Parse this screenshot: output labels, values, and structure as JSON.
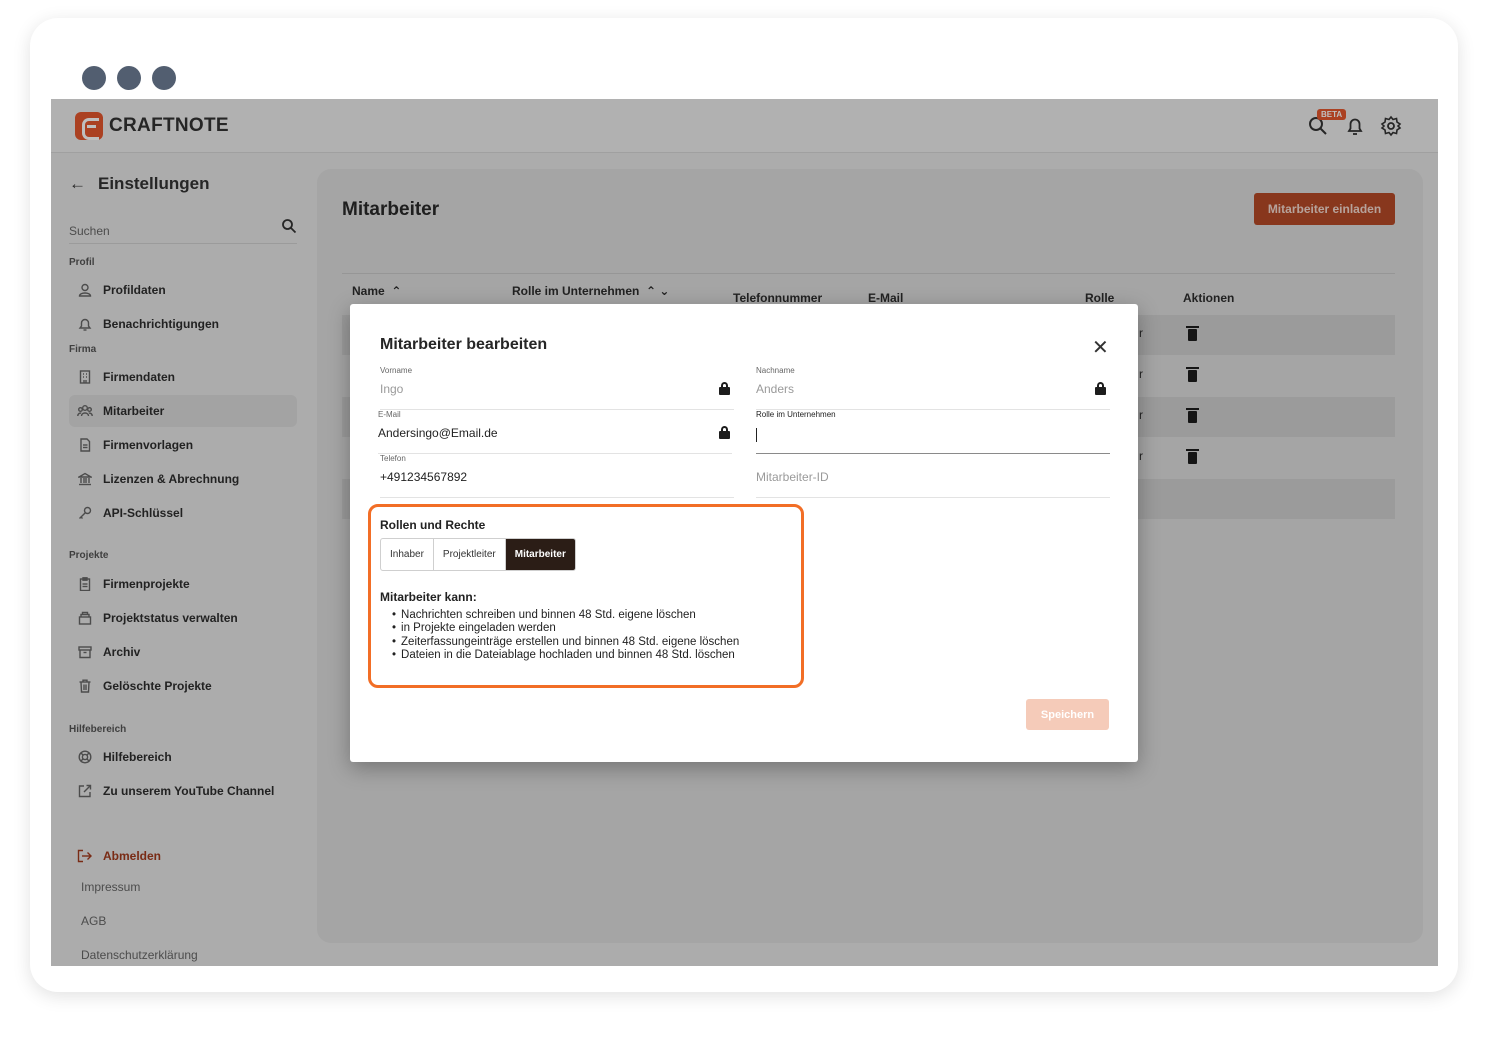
{
  "app": {
    "brand": "CRAFTNOTE",
    "beta_badge": "BETA"
  },
  "sidebar": {
    "back_label": "Einstellungen",
    "search_placeholder": "Suchen",
    "sections": {
      "profil": "Profil",
      "firma": "Firma",
      "projekte": "Projekte",
      "hilfe": "Hilfebereich"
    },
    "items": {
      "profildaten": "Profildaten",
      "benachrichtigungen": "Benachrichtigungen",
      "firmendaten": "Firmendaten",
      "mitarbeiter": "Mitarbeiter",
      "firmenvorlagen": "Firmenvorlagen",
      "lizenzen": "Lizenzen & Abrechnung",
      "api": "API-Schlüssel",
      "firmenprojekte": "Firmenprojekte",
      "projektstatus": "Projektstatus verwalten",
      "archiv": "Archiv",
      "geloeschte": "Gelöschte Projekte",
      "hilfebereich": "Hilfebereich",
      "youtube": "Zu unserem YouTube Channel"
    },
    "logout": "Abmelden",
    "footer": {
      "impressum": "Impressum",
      "agb": "AGB",
      "datenschutz": "Datenschutzerklärung"
    }
  },
  "main": {
    "title": "Mitarbeiter",
    "invite_button": "Mitarbeiter einladen",
    "columns": {
      "name": "Name",
      "rolle_unternehmen": "Rolle im Unternehmen",
      "telefon": "Telefonnummer",
      "email": "E-Mail",
      "rolle": "Rolle",
      "aktionen": "Aktionen"
    },
    "row_role_fragment": "r"
  },
  "modal": {
    "title": "Mitarbeiter bearbeiten",
    "fields": {
      "vorname": {
        "label": "Vorname",
        "value": "Ingo"
      },
      "nachname": {
        "label": "Nachname",
        "value": "Anders"
      },
      "email": {
        "label": "E-Mail",
        "value": "Andersingo@Email.de"
      },
      "rolle": {
        "label": "Rolle im Unternehmen",
        "value": ""
      },
      "telefon": {
        "label": "Telefon",
        "value": "+491234567892"
      },
      "mitarbeiter_id": {
        "placeholder": "Mitarbeiter-ID"
      }
    },
    "roles_title": "Rollen und Rechte",
    "roles": [
      "Inhaber",
      "Projektleiter",
      "Mitarbeiter"
    ],
    "selected_role": "Mitarbeiter",
    "permissions_title": "Mitarbeiter kann:",
    "permissions": [
      "Nachrichten schreiben und binnen 48 Std. eigene löschen",
      "in Projekte eingeladen werden",
      "Zeiterfassungeinträge erstellen und binnen 48 Std. eigene löschen",
      "Dateien in die Dateiablage hochladen und binnen 48 Std. löschen"
    ],
    "save_button": "Speichern"
  },
  "colors": {
    "accent": "#e4572e",
    "highlight": "#f26e26",
    "selected_role_bg": "#2b1d16"
  }
}
